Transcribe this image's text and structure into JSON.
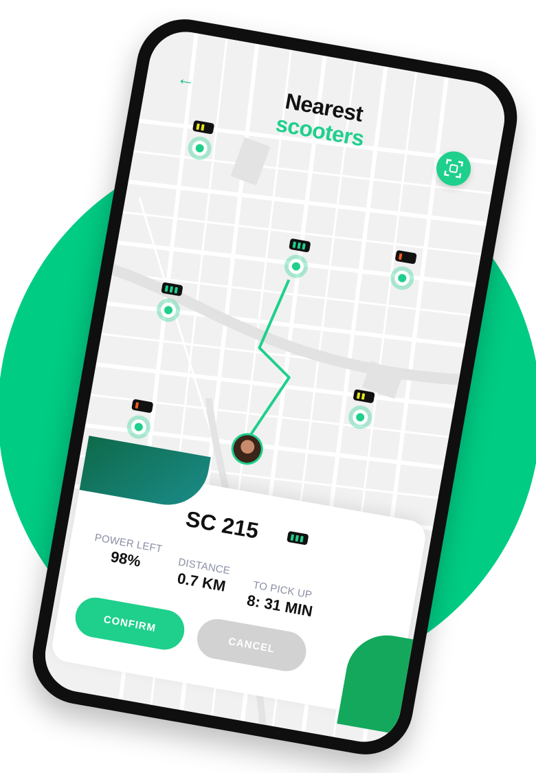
{
  "header": {
    "back_icon": "arrow-left-icon",
    "title_line1": "Nearest",
    "title_line2": "scooters",
    "scan_icon": "scan-icon"
  },
  "colors": {
    "accent": "#1fcf8c",
    "background_circle": "#00cc84",
    "battery_full": "#1fcf8c",
    "battery_medium": "#e6e61e",
    "battery_low": "#ff5a1f"
  },
  "markers": [
    {
      "level": "medium"
    },
    {
      "level": "full"
    },
    {
      "level": "low"
    },
    {
      "level": "full"
    },
    {
      "level": "medium"
    },
    {
      "level": "low"
    }
  ],
  "card": {
    "scooter_id": "SC 215",
    "battery_level": "full",
    "stats": [
      {
        "label": "POWER LEFT",
        "value": "98%"
      },
      {
        "label": "DISTANCE",
        "value": "0.7 KM"
      },
      {
        "label": "TO PICK UP",
        "value": "8: 31 MIN"
      }
    ],
    "confirm_label": "CONFIRM",
    "cancel_label": "CANCEL"
  }
}
